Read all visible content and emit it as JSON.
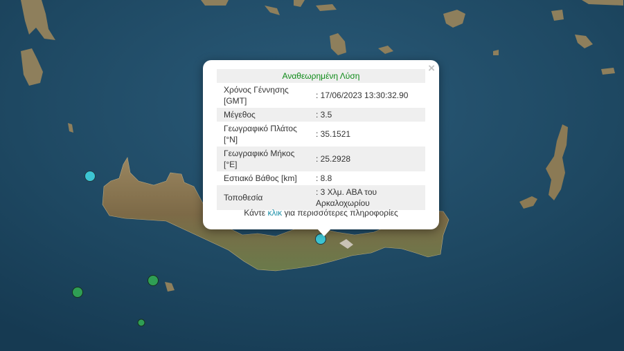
{
  "popup": {
    "title": "Αναθεωρημένη Λύση",
    "close_symbol": "×",
    "rows": [
      {
        "label": "Χρόνος Γέννησης [GMT]",
        "value": ": 17/06/2023 13:30:32.90"
      },
      {
        "label": "Μέγεθος",
        "value": ": 3.5"
      },
      {
        "label": "Γεωγραφικό Πλάτος [°N]",
        "value": ": 35.1521"
      },
      {
        "label": "Γεωγραφικό Μήκος [°E]",
        "value": ": 25.2928"
      },
      {
        "label": "Εστιακό Βάθος [km]",
        "value": ": 8.8"
      },
      {
        "label": "Τοποθεσία",
        "value": ": 3 Χλμ. ΑΒΑ του Αρκαλοχωρίου"
      }
    ],
    "more_prefix": "Κάντε ",
    "more_link": "κλικ",
    "more_suffix": " για περισσότερες πληροφορίες"
  },
  "colors": {
    "sea": "#1d4560",
    "land": "#8a7550",
    "marker_cyan": "#3cc4d2",
    "marker_green": "#2f9e54",
    "title_green": "#0c8a16",
    "link": "#1a8fa8"
  }
}
